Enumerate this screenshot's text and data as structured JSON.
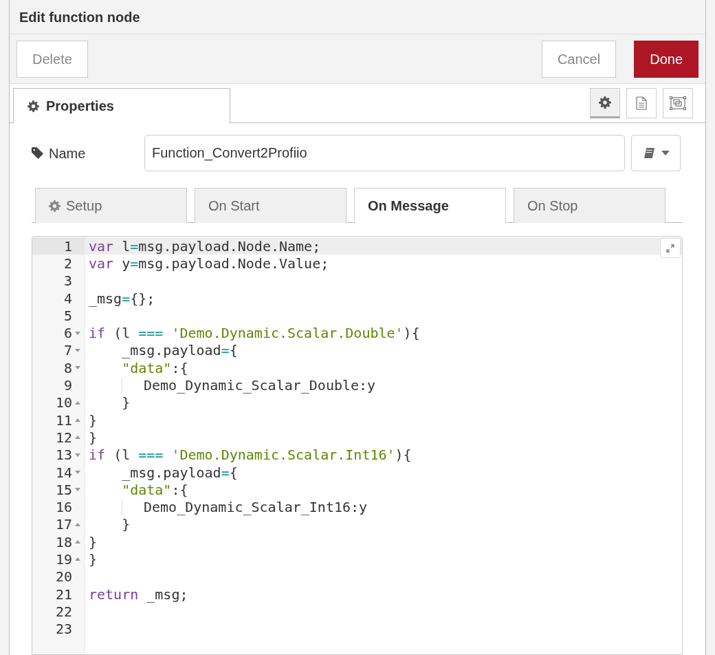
{
  "title": "Edit function node",
  "buttons": [
    {
      "label": "Delete",
      "kind": "plain"
    },
    {
      "label": "Cancel",
      "kind": "plain"
    },
    {
      "label": "Done",
      "kind": "primary"
    }
  ],
  "panel_tab": {
    "label": "Properties",
    "selected": true
  },
  "toolbar": [
    {
      "kind": "gear",
      "selected": true
    },
    {
      "kind": "document",
      "selected": false
    },
    {
      "kind": "frame",
      "selected": false
    }
  ],
  "name_field": {
    "label": "Name",
    "value": "Function_Convert2Profiio"
  },
  "tabs": [
    {
      "label": "Setup",
      "kind": "gear",
      "selected": false
    },
    {
      "label": "On Start",
      "kind": "plain",
      "selected": false
    },
    {
      "label": "On Message",
      "kind": "plain",
      "selected": true
    },
    {
      "label": "On Stop",
      "kind": "plain",
      "selected": false
    }
  ],
  "code_lines": [
    {
      "number": "1",
      "active": true,
      "kind": "plain",
      "guide": false,
      "tokens": [
        {
          "kind": "keyword",
          "text": "var"
        },
        {
          "kind": "plain",
          "text": " l"
        },
        {
          "kind": "operator",
          "text": "="
        },
        {
          "kind": "plain",
          "text": "msg.payload.Node.Name;"
        }
      ]
    },
    {
      "number": "2",
      "active": false,
      "kind": "plain",
      "guide": false,
      "tokens": [
        {
          "kind": "keyword",
          "text": "var"
        },
        {
          "kind": "plain",
          "text": " y"
        },
        {
          "kind": "operator",
          "text": "="
        },
        {
          "kind": "plain",
          "text": "msg.payload.Node.Value;"
        }
      ]
    },
    {
      "number": "3",
      "active": false,
      "kind": "plain",
      "guide": false
    },
    {
      "number": "4",
      "active": false,
      "kind": "plain",
      "guide": false,
      "tokens": [
        {
          "kind": "plain",
          "text": "_msg"
        },
        {
          "kind": "operator",
          "text": "="
        },
        {
          "kind": "plain",
          "text": "{};"
        }
      ]
    },
    {
      "number": "5",
      "active": false,
      "kind": "plain",
      "guide": false
    },
    {
      "number": "6",
      "active": false,
      "kind": "fold-start",
      "guide": false,
      "tokens": [
        {
          "kind": "keyword",
          "text": "if"
        },
        {
          "kind": "plain",
          "text": " (l "
        },
        {
          "kind": "operator",
          "text": "==="
        },
        {
          "kind": "string",
          "text": " 'Demo.Dynamic.Scalar.Double'"
        },
        {
          "kind": "plain",
          "text": "){"
        }
      ]
    },
    {
      "number": "7",
      "active": false,
      "kind": "fold-start",
      "guide": false,
      "tokens": [
        {
          "kind": "plain",
          "text": "    _msg.payload"
        },
        {
          "kind": "operator",
          "text": "="
        },
        {
          "kind": "plain",
          "text": "{"
        }
      ]
    },
    {
      "number": "8",
      "active": false,
      "kind": "fold-start",
      "guide": false,
      "tokens": [
        {
          "kind": "string",
          "text": "    \"data\""
        },
        {
          "kind": "plain",
          "text": ":{"
        }
      ]
    },
    {
      "number": "9",
      "active": false,
      "kind": "plain",
      "guide": true,
      "tokens": [
        {
          "kind": "plain",
          "text": "Demo_Dynamic_Scalar_Double:y"
        }
      ]
    },
    {
      "number": "10",
      "active": false,
      "kind": "fold-end",
      "guide": false,
      "tokens": [
        {
          "kind": "plain",
          "text": "    }"
        }
      ]
    },
    {
      "number": "11",
      "active": false,
      "kind": "fold-end",
      "guide": false,
      "tokens": [
        {
          "kind": "plain",
          "text": "}"
        }
      ]
    },
    {
      "number": "12",
      "active": false,
      "kind": "fold-end",
      "guide": false,
      "tokens": [
        {
          "kind": "plain",
          "text": "}"
        }
      ]
    },
    {
      "number": "13",
      "active": false,
      "kind": "fold-start",
      "guide": false,
      "tokens": [
        {
          "kind": "keyword",
          "text": "if"
        },
        {
          "kind": "plain",
          "text": " (l "
        },
        {
          "kind": "operator",
          "text": "==="
        },
        {
          "kind": "string",
          "text": " 'Demo.Dynamic.Scalar.Int16'"
        },
        {
          "kind": "plain",
          "text": "){"
        }
      ]
    },
    {
      "number": "14",
      "active": false,
      "kind": "fold-start",
      "guide": false,
      "tokens": [
        {
          "kind": "plain",
          "text": "    _msg.payload"
        },
        {
          "kind": "operator",
          "text": "="
        },
        {
          "kind": "plain",
          "text": "{"
        }
      ]
    },
    {
      "number": "15",
      "active": false,
      "kind": "fold-start",
      "guide": false,
      "tokens": [
        {
          "kind": "string",
          "text": "    \"data\""
        },
        {
          "kind": "plain",
          "text": ":{"
        }
      ]
    },
    {
      "number": "16",
      "active": false,
      "kind": "plain",
      "guide": true,
      "tokens": [
        {
          "kind": "plain",
          "text": "Demo_Dynamic_Scalar_Int16:y"
        }
      ]
    },
    {
      "number": "17",
      "active": false,
      "kind": "fold-end",
      "guide": false,
      "tokens": [
        {
          "kind": "plain",
          "text": "    }"
        }
      ]
    },
    {
      "number": "18",
      "active": false,
      "kind": "fold-end",
      "guide": false,
      "tokens": [
        {
          "kind": "plain",
          "text": "}"
        }
      ]
    },
    {
      "number": "19",
      "active": false,
      "kind": "fold-end",
      "guide": false,
      "tokens": [
        {
          "kind": "plain",
          "text": "}"
        }
      ]
    },
    {
      "number": "20",
      "active": false,
      "kind": "plain",
      "guide": false
    },
    {
      "number": "21",
      "active": false,
      "kind": "plain",
      "guide": false,
      "tokens": [
        {
          "kind": "keyword",
          "text": "return"
        },
        {
          "kind": "plain",
          "text": " _msg;"
        }
      ]
    },
    {
      "number": "22",
      "active": false,
      "kind": "plain",
      "guide": false
    },
    {
      "number": "23",
      "active": false,
      "kind": "plain",
      "guide": false
    }
  ]
}
